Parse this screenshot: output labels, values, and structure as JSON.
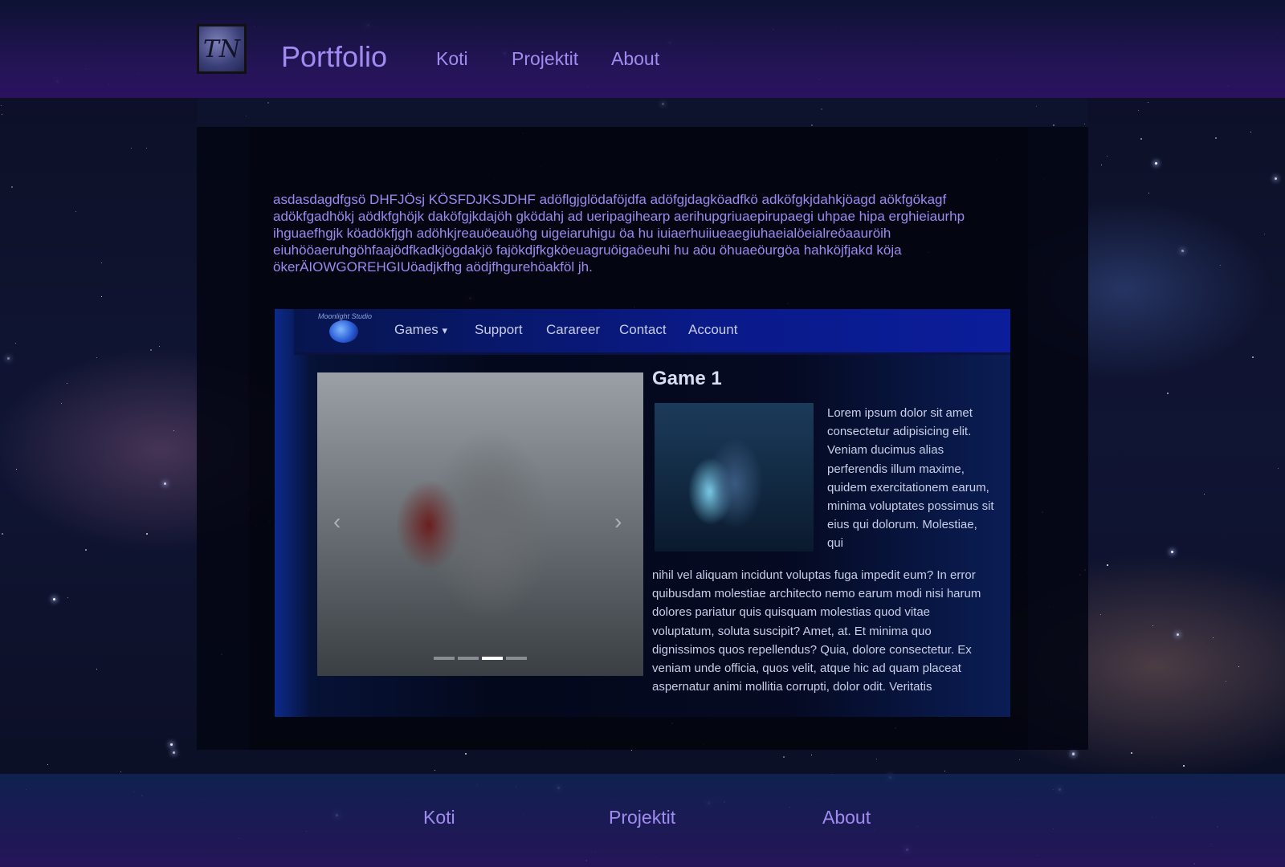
{
  "header": {
    "logo_text": "TN",
    "brand": "Portfolio",
    "nav": [
      "Koti",
      "Projektit",
      "About"
    ]
  },
  "main": {
    "intro": "asdasdagdfgsö DHFJÖsj KÖSFDJKSJDHF adöflgjglödaföjdfa adöfgjdagköadfkö adköfgkjdahkjöagd aökfgökagf adökfgadhökj  aödkfghöjk daköfgjkdajöh gködahj ad  ueripagihearp  aerihupgriuaepirupaegi uhpae hipa erghieiaurhp ihguaefhgjk köadökfjgh adöhkjreauöeauöhg uigeiaruhigu öa hu iuiaerhuiiueaegiuhaeialöeialreöaauröih eiuhööaeruhgöhfaajödfkadkjögdakjö fajökdjfkgköeuagruöigaöeuhi hu aöu öhuaeöurgöa hahköjfjakd köja ökerÄIOWGOREHGIUöadjkfhg aödjfhgurehöakföl jh.",
    "screenshot": {
      "studio_label": "Moonlight Studio",
      "nav": [
        "Games",
        "Support",
        "Carareer",
        "Contact",
        "Account"
      ],
      "games_caret": "▾",
      "game_title": "Game 1",
      "desc_top": "Lorem ipsum dolor sit amet consectetur adipisicing elit. Veniam ducimus alias perferendis illum maxime, quidem exercitationem earum, minima voluptates possimus sit eius qui dolorum. Molestiae, qui",
      "desc_bottom": "nihil vel aliquam incidunt voluptas fuga impedit eum? In error quibusdam molestiae architecto nemo earum modi nisi harum dolores pariatur quis quisquam molestias quod vitae voluptatum, soluta suscipit? Amet, at. Et minima quo dignissimos quos repellendus? Quia, dolore consectetur. Ex veniam unde officia, quos velit, atque hic ad quam placeat aspernatur animi mollitia corrupti, dolor odit. Veritatis",
      "carousel_prev": "‹",
      "carousel_next": "›",
      "carousel_slides": 4,
      "carousel_active": 3
    }
  },
  "footer": {
    "nav": [
      "Koti",
      "Projektit",
      "About"
    ]
  },
  "colors": {
    "accent": "#a08cf0",
    "header_bg": "#2c1262",
    "screenshot_nav": "#0a1a8a"
  }
}
